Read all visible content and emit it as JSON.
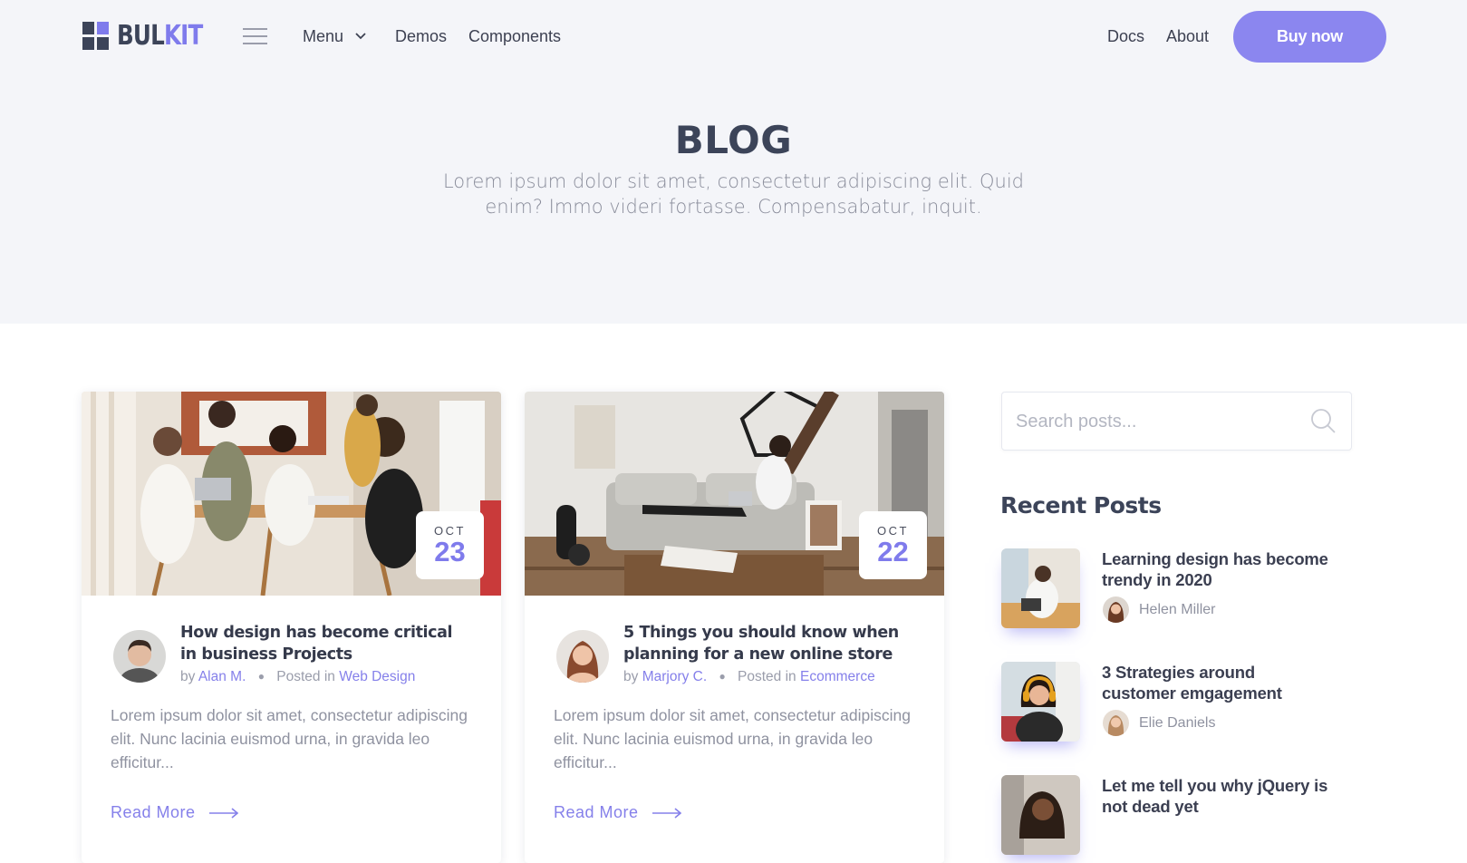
{
  "nav": {
    "logo_part1": "BUL",
    "logo_part2": "KIT",
    "menu_label": "Menu",
    "demos_label": "Demos",
    "components_label": "Components",
    "docs_label": "Docs",
    "about_label": "About",
    "buy_label": "Buy now"
  },
  "hero": {
    "title": "BLOG",
    "subtitle": "Lorem ipsum dolor sit amet, consectetur adipiscing elit. Quid enim? Immo videri fortasse. Compensabatur, inquit."
  },
  "posts": [
    {
      "month": "OCT",
      "day": "23",
      "title": "How design has become critical in business Projects",
      "by_prefix": "by",
      "author": "Alan M.",
      "posted_prefix": "Posted in",
      "category": "Web Design",
      "excerpt": "Lorem ipsum dolor sit amet, consectetur adipiscing elit. Nunc lacinia euismod urna, in gravida leo efficitur...",
      "read_more": "Read More"
    },
    {
      "month": "OCT",
      "day": "22",
      "title": "5 Things you should know when planning for a new online store",
      "by_prefix": "by",
      "author": "Marjory C.",
      "posted_prefix": "Posted in",
      "category": "Ecommerce",
      "excerpt": "Lorem ipsum dolor sit amet, consectetur adipiscing elit. Nunc lacinia euismod urna, in gravida leo efficitur...",
      "read_more": "Read More"
    }
  ],
  "sidebar": {
    "search_placeholder": "Search posts...",
    "recent_title": "Recent Posts",
    "recent": [
      {
        "title_bold": "Learning design has become",
        "title_rest": "trendy in 2020",
        "author": "Helen Miller"
      },
      {
        "title_bold": "3 Strategies around",
        "title_rest": "customer emgagement",
        "author": "Elie Daniels"
      },
      {
        "title_bold": "Let me tell you why jQuery is",
        "title_rest": "not dead yet",
        "author": ""
      }
    ]
  },
  "colors": {
    "accent": "#7f7bec",
    "dark": "#3c4459",
    "hero_bg": "#f4f5f9"
  }
}
